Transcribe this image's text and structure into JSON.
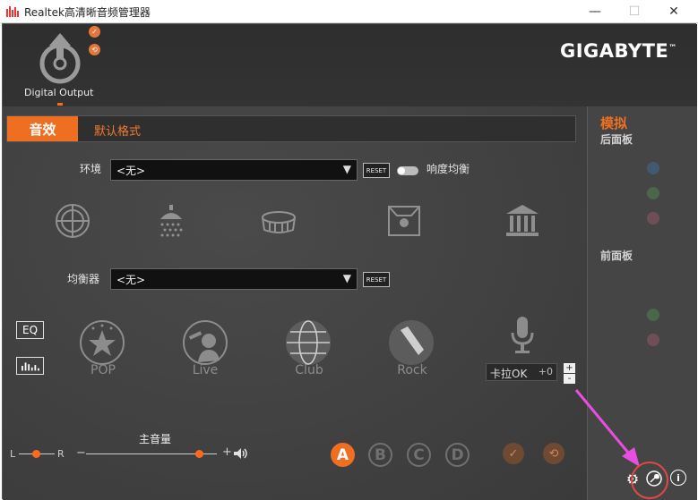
{
  "window": {
    "title": "Realtek高清晰音频管理器",
    "minimize": "—",
    "maximize": "☐",
    "close": "✕"
  },
  "device": {
    "label": "Digital Output",
    "badges": [
      "✓",
      "⟲"
    ]
  },
  "brand": "GIGABYTE",
  "brand_tm": "™",
  "tabs": [
    {
      "label": "音效",
      "active": true
    },
    {
      "label": "默认格式",
      "active": false
    }
  ],
  "environment": {
    "label": "环境",
    "value": "<无>",
    "reset_label": "RESET",
    "loudness_label": "响度均衡",
    "icons": [
      "stone-corridor-icon",
      "shower-icon",
      "stadium-icon",
      "room-icon",
      "auditorium-icon"
    ]
  },
  "equalizer": {
    "label": "均衡器",
    "value": "<无>",
    "reset_label": "RESET",
    "eq_button": "EQ",
    "presets": [
      {
        "label": "POP",
        "icon": "star-icon"
      },
      {
        "label": "Live",
        "icon": "singer-icon"
      },
      {
        "label": "Club",
        "icon": "disco-ball-icon"
      },
      {
        "label": "Rock",
        "icon": "guitar-icon"
      }
    ]
  },
  "karaoke": {
    "label": "卡拉OK",
    "value": "+0",
    "plus": "+",
    "minus": "-"
  },
  "volume": {
    "label": "主音量",
    "left": "L",
    "right": "R",
    "minus": "−",
    "plus": "+",
    "balance_level": 0.5,
    "volume_level": 0.95
  },
  "profiles": [
    "A",
    "B",
    "C",
    "D"
  ],
  "right_panel": {
    "title": "模拟",
    "rear": "后面板",
    "front": "前面板"
  },
  "footer": {
    "settings": "⚙",
    "wrench": "🔧",
    "info": "i"
  },
  "colors": {
    "accent": "#ef6f22",
    "annotation": "#e84fe0",
    "circle": "#e04848"
  }
}
